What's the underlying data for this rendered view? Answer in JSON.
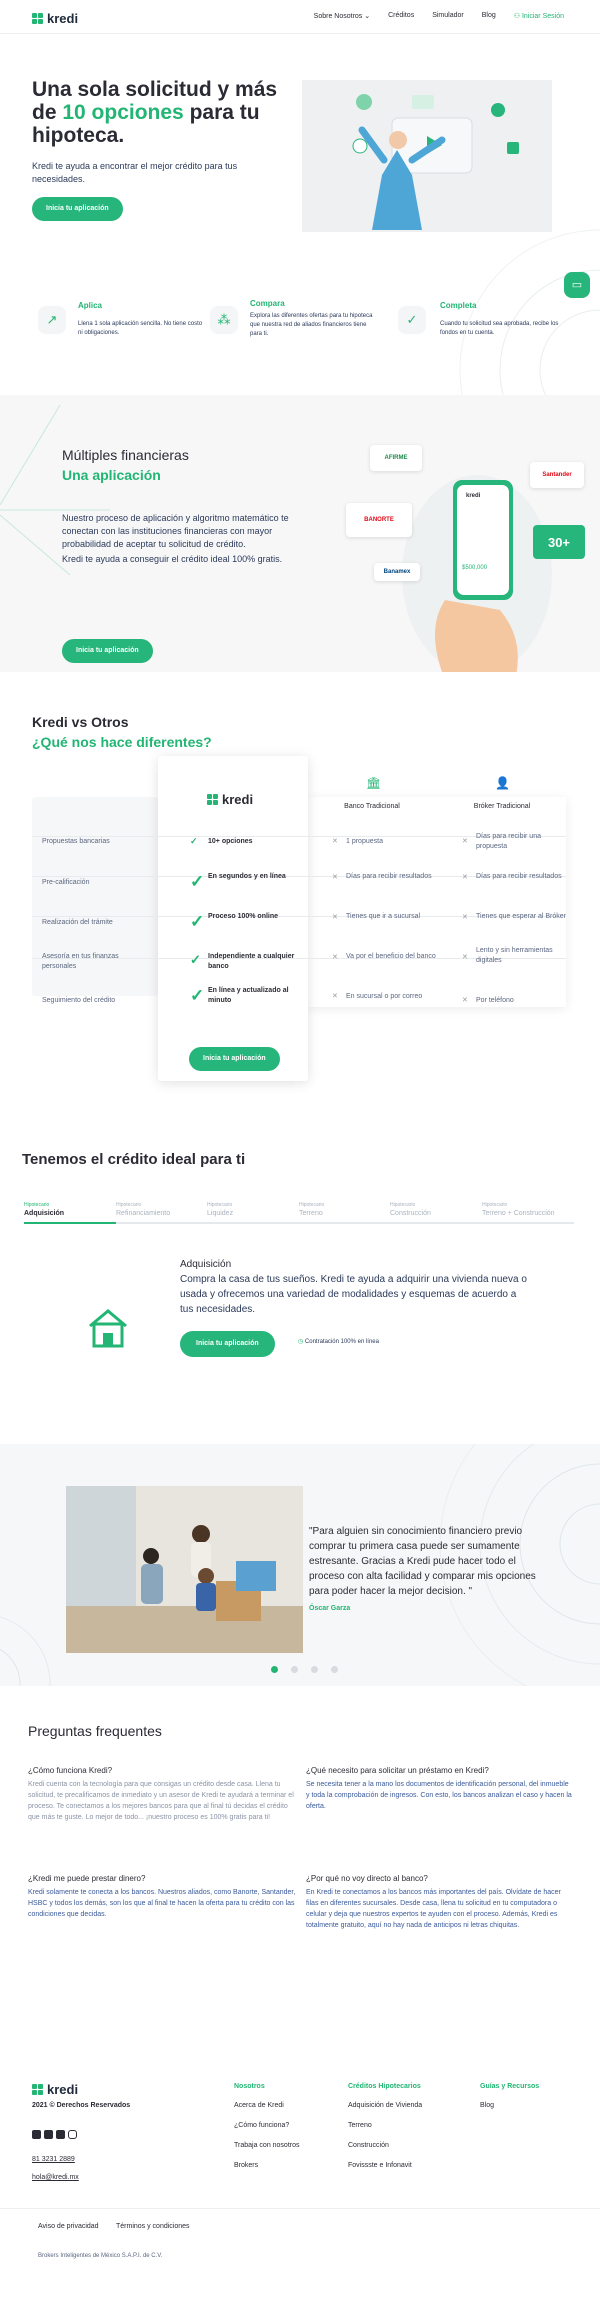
{
  "brand": {
    "name": "kredi",
    "green": "#22b573"
  },
  "nav": {
    "items": [
      "Sobre Nosotros",
      "Créditos",
      "Simulador",
      "Blog"
    ],
    "login": "Iniciar Sesión"
  },
  "hero": {
    "title_part1": "Una sola solicitud y más de ",
    "title_highlight": "10 opciones",
    "title_part2": " para tu hipoteca.",
    "subtitle": "Kredi te ayuda a encontrar el mejor crédito para tus necesidades.",
    "cta": "Inicia tu aplicación"
  },
  "steps": [
    {
      "title": "Aplica",
      "desc": "Llena 1 sola aplicación sencilla. No tiene costo ni obligaciones."
    },
    {
      "title": "Compara",
      "desc": "Explora las diferentes ofertas para tu hipoteca que nuestra red de aliados financieros tiene para ti."
    },
    {
      "title": "Completa",
      "desc": "Cuando tu solicitud sea aprobada, recibe los fondos en tu cuenta."
    }
  ],
  "multiples": {
    "title": "Múltiples financieras",
    "subtitle": "Una aplicación",
    "p1": "Nuestro proceso de aplicación y algoritmo matemático te conectan con las instituciones financieras con mayor probabilidad de aceptar tu solicitud de crédito.",
    "p2": "Kredi te ayuda a conseguir el crédito ideal 100% gratis.",
    "cta": "Inicia tu aplicación",
    "banks": [
      "AFIRME",
      "Santander",
      "BANORTE",
      "Banamex",
      "30+"
    ],
    "phone_amount": "$500,000",
    "phone_brand": "kredi"
  },
  "compare": {
    "title": "Kredi vs Otros",
    "subtitle": "¿Qué nos hace diferentes?",
    "col_kredi": "kredi",
    "col_bank": "Banco Tradicional",
    "col_broker": "Bróker Tradicional",
    "rows": [
      {
        "label": "Propuestas bancarias",
        "kredi": "10+ opciones",
        "bank": "1 propuesta",
        "broker": "Días para recibir una propuesta"
      },
      {
        "label": "Pre-calificación",
        "kredi": "En segundos y en línea",
        "bank": "Días para recibir resultados",
        "broker": "Días para recibir resultados"
      },
      {
        "label": "Realización del trámite",
        "kredi": "Proceso 100% online",
        "bank": "Tienes que ir a sucursal",
        "broker": "Tienes que esperar al Bróker"
      },
      {
        "label": "Asesoría en tus finanzas personales",
        "kredi": "Independiente a cualquier banco",
        "bank": "Va por el beneficio del banco",
        "broker": "Lento y sin herramientas digitales"
      },
      {
        "label": "Seguimiento del crédito",
        "kredi": "En línea y actualizado al minuto",
        "bank": "En sucursal o por correo",
        "broker": "Por teléfono"
      }
    ],
    "cta": "Inicia tu aplicación"
  },
  "credits": {
    "title": "Tenemos el crédito ideal para ti",
    "tabs": [
      {
        "small": "Hipotecario",
        "label": "Adquisición"
      },
      {
        "small": "Hipotecario",
        "label": "Refinanciamiento"
      },
      {
        "small": "Hipotecario",
        "label": "Liquidez"
      },
      {
        "small": "Hipotecario",
        "label": "Terreno"
      },
      {
        "small": "Hipotecario",
        "label": "Construcción"
      },
      {
        "small": "Hipotecario",
        "label": "Terreno + Construcción"
      }
    ],
    "detail_title": "Adquisición",
    "detail_text": "Compra la casa de tus sueños. Kredi te ayuda a adquirir una vivienda nueva o usada y ofrecemos una variedad de modalidades y esquemas de acuerdo a tus necesidades.",
    "cta": "Inicia tu aplicación",
    "note": "Contratación 100% en línea"
  },
  "testimonial": {
    "quote": "\"Para alguien sin conocimiento financiero previo comprar tu primera casa puede ser sumamente estresante. Gracias a Kredi pude hacer todo el proceso con alta facilidad y comparar mis opciones para poder hacer la mejor decision. \"",
    "name": "Óscar Garza"
  },
  "faq": {
    "title": "Preguntas frequentes",
    "items": [
      {
        "q": "¿Cómo funciona Kredi?",
        "a": "Kredi cuenta con la tecnología para que consigas un crédito desde casa. Llena tu solicitud, te precalificamos de inmediato y un asesor de Kredi te ayudará a terminar el proceso. Te conectamos a los mejores bancos para que al final tú decidas el crédito que más te guste. Lo mejor de todo... ¡nuestro proceso es 100% gratis para ti!"
      },
      {
        "q": "¿Qué necesito para solicitar un préstamo en Kredi?",
        "a": "Se necesita tener a la mano los documentos de identificación personal, del inmueble y toda la comprobación de ingresos. Con esto, los bancos analizan el caso y hacen la oferta."
      },
      {
        "q": "¿Kredi me puede prestar dinero?",
        "a": "Kredi solamente te conecta a los bancos. Nuestros aliados, como Banorte, Santander, HSBC y todos los demás, son los que al final te hacen la oferta para tu crédito con las condiciones que decidas."
      },
      {
        "q": "¿Por qué no voy directo al banco?",
        "a": "En Kredi te conectamos a los bancos más importantes del país. Olvídate de hacer filas en diferentes sucursales. Desde casa, llena tu solicitud en tu computadora o celular y deja que nuestros expertos te ayuden con el proceso. Además, Kredi es totalmente gratuito, aquí no hay nada de anticipos ni letras chiquitas."
      }
    ]
  },
  "footer": {
    "copyright": "2021 © Derechos Reservados",
    "phone": "81 3231 2889",
    "email": "hola@kredi.mx",
    "col1_title": "Nosotros",
    "col1": [
      "Acerca de Kredi",
      "¿Cómo funciona?",
      "Trabaja con nosotros",
      "Brokers"
    ],
    "col2_title": "Créditos Hipotecarios",
    "col2": [
      "Adquisición de Vivienda",
      "Terreno",
      "Construcción",
      "Fovissste e Infonavit"
    ],
    "col3_title": "Guías y Recursos",
    "col3": [
      "Blog"
    ],
    "legal": [
      "Aviso de privacidad",
      "Términos y condiciones"
    ],
    "company": "Brokers Inteligentes de México S.A.P.I. de C.V."
  }
}
